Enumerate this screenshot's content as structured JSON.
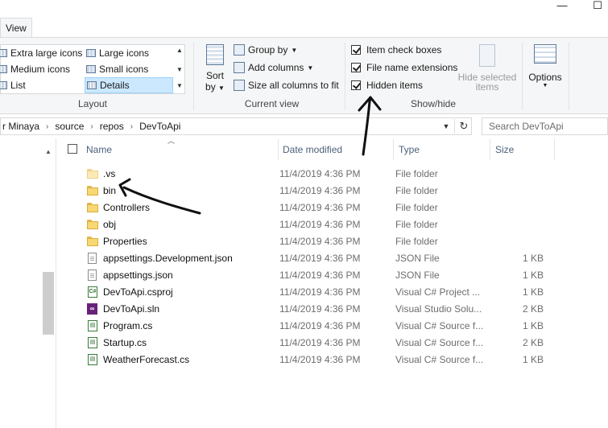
{
  "window": {
    "minimize_glyph": "—",
    "maximize_glyph": "☐"
  },
  "tabs": {
    "view_label": "View"
  },
  "ribbon": {
    "layout": {
      "items": [
        {
          "label": "Extra large icons"
        },
        {
          "label": "Large icons"
        },
        {
          "label": "Medium icons"
        },
        {
          "label": "Small icons"
        },
        {
          "label": "List"
        },
        {
          "label": "Details"
        }
      ],
      "group_label": "Layout"
    },
    "current_view": {
      "sort_label": "Sort",
      "sort_by_label": "by",
      "group_by_label": "Group by",
      "add_columns_label": "Add columns",
      "size_columns_label": "Size all columns to fit",
      "group_label": "Current view"
    },
    "show_hide": {
      "item_check_boxes": {
        "label": "Item check boxes",
        "checked": true
      },
      "file_name_extensions": {
        "label": "File name extensions",
        "checked": true
      },
      "hidden_items": {
        "label": "Hidden items",
        "checked": true
      },
      "hide_selected_label_1": "Hide selected",
      "hide_selected_label_2": "items",
      "group_label": "Show/hide"
    },
    "options": {
      "label": "Options"
    }
  },
  "address": {
    "crumbs": [
      "r Minaya",
      "source",
      "repos",
      "DevToApi"
    ]
  },
  "search": {
    "placeholder": "Search DevToApi"
  },
  "columns": {
    "name": "Name",
    "date": "Date modified",
    "type": "Type",
    "size": "Size"
  },
  "files": [
    {
      "name": ".vs",
      "date": "11/4/2019 4:36 PM",
      "type": "File folder",
      "size": "",
      "icon": "hidden-folder-icon"
    },
    {
      "name": "bin",
      "date": "11/4/2019 4:36 PM",
      "type": "File folder",
      "size": "",
      "icon": "folder-icon"
    },
    {
      "name": "Controllers",
      "date": "11/4/2019 4:36 PM",
      "type": "File folder",
      "size": "",
      "icon": "folder-icon"
    },
    {
      "name": "obj",
      "date": "11/4/2019 4:36 PM",
      "type": "File folder",
      "size": "",
      "icon": "folder-icon"
    },
    {
      "name": "Properties",
      "date": "11/4/2019 4:36 PM",
      "type": "File folder",
      "size": "",
      "icon": "folder-icon"
    },
    {
      "name": "appsettings.Development.json",
      "date": "11/4/2019 4:36 PM",
      "type": "JSON File",
      "size": "1 KB",
      "icon": "json-file-icon"
    },
    {
      "name": "appsettings.json",
      "date": "11/4/2019 4:36 PM",
      "type": "JSON File",
      "size": "1 KB",
      "icon": "json-file-icon"
    },
    {
      "name": "DevToApi.csproj",
      "date": "11/4/2019 4:36 PM",
      "type": "Visual C# Project ...",
      "size": "1 KB",
      "icon": "csproj-icon"
    },
    {
      "name": "DevToApi.sln",
      "date": "11/4/2019 4:36 PM",
      "type": "Visual Studio Solu...",
      "size": "2 KB",
      "icon": "sln-icon"
    },
    {
      "name": "Program.cs",
      "date": "11/4/2019 4:36 PM",
      "type": "Visual C# Source f...",
      "size": "1 KB",
      "icon": "cs-file-icon"
    },
    {
      "name": "Startup.cs",
      "date": "11/4/2019 4:36 PM",
      "type": "Visual C# Source f...",
      "size": "2 KB",
      "icon": "cs-file-icon"
    },
    {
      "name": "WeatherForecast.cs",
      "date": "11/4/2019 4:36 PM",
      "type": "Visual C# Source f...",
      "size": "1 KB",
      "icon": "cs-file-icon"
    }
  ],
  "annotation_color": "#111111"
}
